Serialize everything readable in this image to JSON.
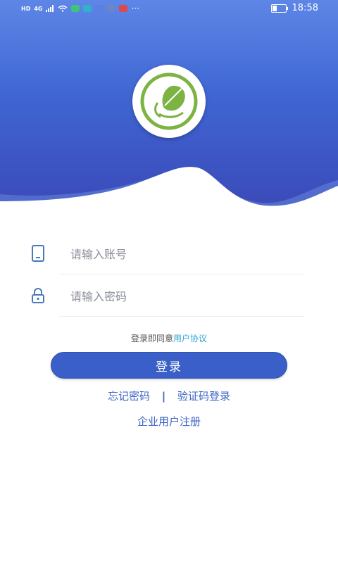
{
  "status_bar": {
    "hd_badge": "HD",
    "network": "4G",
    "more": "···",
    "time": "18:58",
    "battery_level": 0.35
  },
  "form": {
    "account_placeholder": "请输入账号",
    "password_placeholder": "请输入密码"
  },
  "agreement": {
    "prefix": "登录即同意",
    "link": "用户协议"
  },
  "buttons": {
    "login": "登录",
    "forgot_password": "忘记密码",
    "separator": "|",
    "sms_login": "验证码登录",
    "enterprise_register": "企业用户注册"
  },
  "colors": {
    "header_top": "#5d86e6",
    "header_bottom": "#3b49b8",
    "accent": "#3a5fc8",
    "link": "#2ea3d8",
    "leaf_green": "#7cb342"
  },
  "icons": {
    "logo": "leaf-logo-icon",
    "account": "phone-icon",
    "password": "lock-icon"
  }
}
